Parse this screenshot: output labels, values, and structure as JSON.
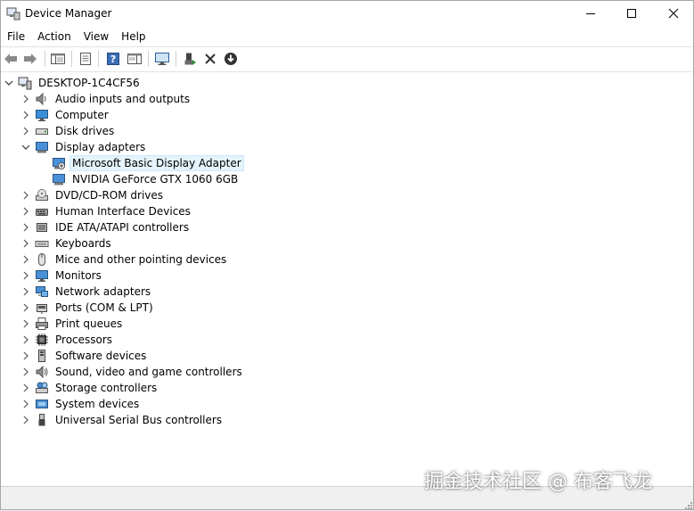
{
  "window": {
    "title": "Device Manager"
  },
  "menu": {
    "items": [
      "File",
      "Action",
      "View",
      "Help"
    ]
  },
  "toolbar": {
    "buttons": [
      {
        "name": "back-button",
        "icon": "arrow-left-icon"
      },
      {
        "name": "forward-button",
        "icon": "arrow-right-icon"
      },
      {
        "name": "show-hide-console-tree-button",
        "icon": "console-tree-icon"
      },
      {
        "name": "properties-button",
        "icon": "properties-icon"
      },
      {
        "name": "help-button",
        "icon": "help-icon"
      },
      {
        "name": "action-pane-button",
        "icon": "action-pane-icon"
      },
      {
        "name": "scan-hardware-button",
        "icon": "monitor-scan-icon"
      },
      {
        "name": "update-driver-button",
        "icon": "update-driver-icon"
      },
      {
        "name": "uninstall-device-button",
        "icon": "x-icon"
      },
      {
        "name": "download-button",
        "icon": "download-circle-icon"
      }
    ]
  },
  "tree": {
    "root": "DESKTOP-1C4CF56",
    "categories": [
      {
        "label": "Audio inputs and outputs",
        "icon": "speaker-icon",
        "expanded": false
      },
      {
        "label": "Computer",
        "icon": "computer-icon",
        "expanded": false
      },
      {
        "label": "Disk drives",
        "icon": "disk-drive-icon",
        "expanded": false
      },
      {
        "label": "Display adapters",
        "icon": "display-adapter-icon",
        "expanded": true,
        "children": [
          {
            "label": "Microsoft Basic Display Adapter",
            "icon": "display-adapter-warning-icon",
            "selected": true
          },
          {
            "label": "NVIDIA GeForce GTX 1060 6GB",
            "icon": "display-adapter-icon",
            "selected": false
          }
        ]
      },
      {
        "label": "DVD/CD-ROM drives",
        "icon": "dvd-drive-icon",
        "expanded": false
      },
      {
        "label": "Human Interface Devices",
        "icon": "hid-icon",
        "expanded": false
      },
      {
        "label": "IDE ATA/ATAPI controllers",
        "icon": "ide-controller-icon",
        "expanded": false
      },
      {
        "label": "Keyboards",
        "icon": "keyboard-icon",
        "expanded": false
      },
      {
        "label": "Mice and other pointing devices",
        "icon": "mouse-icon",
        "expanded": false
      },
      {
        "label": "Monitors",
        "icon": "monitor-icon",
        "expanded": false
      },
      {
        "label": "Network adapters",
        "icon": "network-adapter-icon",
        "expanded": false
      },
      {
        "label": "Ports (COM & LPT)",
        "icon": "port-icon",
        "expanded": false
      },
      {
        "label": "Print queues",
        "icon": "printer-icon",
        "expanded": false
      },
      {
        "label": "Processors",
        "icon": "processor-icon",
        "expanded": false
      },
      {
        "label": "Software devices",
        "icon": "software-device-icon",
        "expanded": false
      },
      {
        "label": "Sound, video and game controllers",
        "icon": "sound-controller-icon",
        "expanded": false
      },
      {
        "label": "Storage controllers",
        "icon": "storage-controller-icon",
        "expanded": false
      },
      {
        "label": "System devices",
        "icon": "system-device-icon",
        "expanded": false
      },
      {
        "label": "Universal Serial Bus controllers",
        "icon": "usb-icon",
        "expanded": false
      }
    ]
  },
  "watermark": "掘金技术社区 @ 布客飞龙",
  "colors": {
    "selection_bg": "#e5f3fb",
    "selection_border": "#cce8ff",
    "icon_blue": "#2b79d0",
    "icon_gray": "#6b6b6b"
  }
}
